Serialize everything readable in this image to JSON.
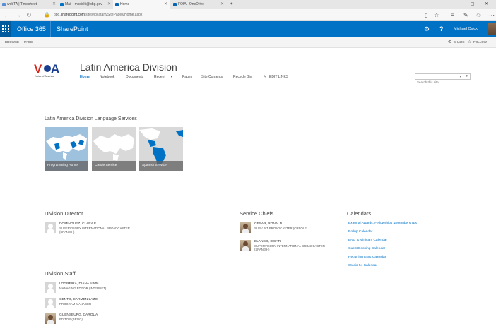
{
  "browser": {
    "tabs": [
      {
        "label": "webTA | Timesheet",
        "active": false,
        "favicon_color": "#5a8fd6"
      },
      {
        "label": "Mail - mcsicki@bbg.gov",
        "active": false,
        "favicon_color": "#0072c6"
      },
      {
        "label": "Home",
        "active": true,
        "favicon_color": "#0a64b4"
      },
      {
        "label": "FOIA - OneDrive",
        "active": false,
        "favicon_color": "#0a64b4"
      }
    ],
    "new_tab": "+",
    "url_prefix": "bbg.",
    "url_domain": "sharepoint.com",
    "url_path": "/sites/lp/latam/SitePages/Home.aspx",
    "window_controls": [
      "–",
      "▢",
      "✕"
    ]
  },
  "suite_bar": {
    "product": "Office 365",
    "app": "SharePoint",
    "user": "Michael Csicki",
    "color": "#0072c6"
  },
  "ribbon": {
    "tabs": [
      "BROWSE",
      "PAGE"
    ],
    "share": "SHARE",
    "follow": "FOLLOW"
  },
  "site": {
    "logo_caption": "Voice of America",
    "title": "Latin America Division",
    "nav": [
      "Home",
      "Notebook",
      "Documents",
      "Recent",
      "Pages",
      "Site Contents",
      "Recycle Bin"
    ],
    "edit_links": "EDIT LINKS",
    "search_placeholder": "Search this site"
  },
  "language_services": {
    "title": "Latin America Division Language Services",
    "tiles": [
      "Programming Home",
      "Creole Service",
      "Spanish Service"
    ]
  },
  "division_director": {
    "title": "Division Director",
    "people": [
      {
        "name": "DOMINGUEZ, CLARA E",
        "title_lines": [
          "SUPERVISORY INTERNATIONAL BROADCASTER",
          "(SPANISH)"
        ]
      }
    ]
  },
  "service_chiefs": {
    "title": "Service Chiefs",
    "people": [
      {
        "name": "CESAR, RONALD",
        "title_lines": [
          "SUPV INT BROADCASTER (CREOLE)"
        ]
      },
      {
        "name": "BLANCO, ISCAR",
        "title_lines": [
          "SUPERVISORY INTERNATIONAL BROADCASTER",
          "(SPANISH)"
        ]
      }
    ]
  },
  "calendars": {
    "title": "Calendars",
    "links": [
      "External Awards, Fellowships & Memberships",
      "Rollup Calendar",
      "ENG & Minicam Calendar",
      "Guest Booking Calendar",
      "Recurring ENG Calendar",
      "Studio 54 Calendar"
    ]
  },
  "division_staff": {
    "title": "Division Staff",
    "people": [
      {
        "name": "LOGREIRA, DIANA NIMN",
        "title_lines": [
          "MANAGING EDITOR (INTERNET)"
        ]
      },
      {
        "name": "CENTO, CARMEN LAZO",
        "title_lines": [
          "PROGRAM MANAGER"
        ]
      },
      {
        "name": "GUENSBURG, CAROL A",
        "title_lines": [
          "EDITOR (BROG)"
        ]
      }
    ]
  }
}
